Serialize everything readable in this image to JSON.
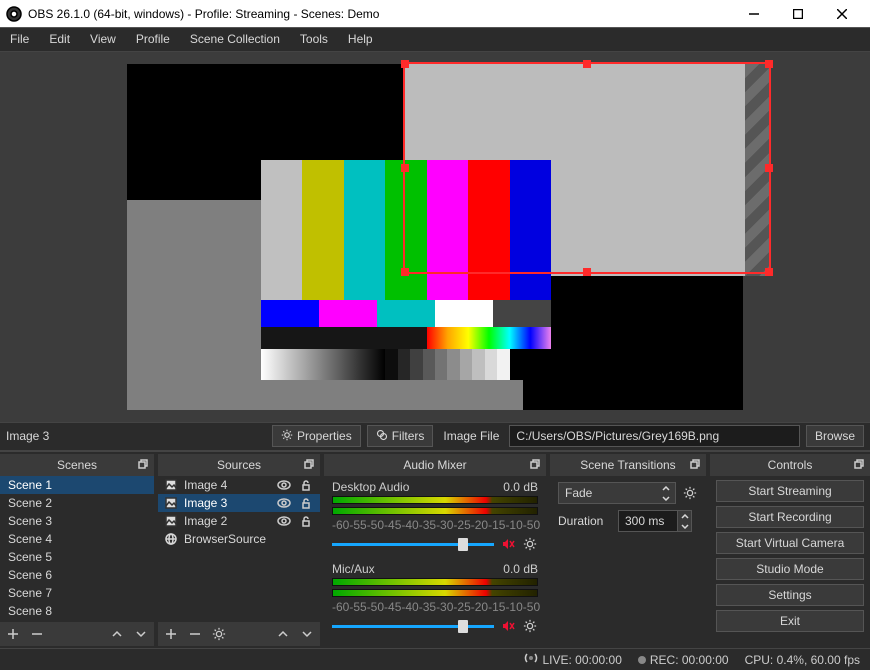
{
  "titlebar": {
    "title": "OBS 26.1.0 (64-bit, windows) - Profile: Streaming - Scenes: Demo"
  },
  "menubar": [
    "File",
    "Edit",
    "View",
    "Profile",
    "Scene Collection",
    "Tools",
    "Help"
  ],
  "propbar": {
    "selected": "Image 3",
    "properties": "Properties",
    "filters": "Filters",
    "file_label": "Image File",
    "file_path": "C:/Users/OBS/Pictures/Grey169B.png",
    "browse": "Browse"
  },
  "docks": {
    "scenes": {
      "title": "Scenes",
      "items": [
        "Scene 1",
        "Scene 2",
        "Scene 3",
        "Scene 4",
        "Scene 5",
        "Scene 6",
        "Scene 7",
        "Scene 8"
      ],
      "selected_index": 0
    },
    "sources": {
      "title": "Sources",
      "items": [
        {
          "name": "Image 4",
          "icon": "image",
          "visible": true,
          "locked": false,
          "selected": false
        },
        {
          "name": "Image 3",
          "icon": "image",
          "visible": true,
          "locked": false,
          "selected": true
        },
        {
          "name": "Image 2",
          "icon": "image",
          "visible": true,
          "locked": false,
          "selected": false
        },
        {
          "name": "BrowserSource",
          "icon": "globe",
          "visible": true,
          "locked": false,
          "selected": false
        }
      ]
    },
    "mixer": {
      "title": "Audio Mixer",
      "ticks": [
        "-60",
        "-55",
        "-50",
        "-45",
        "-40",
        "-35",
        "-30",
        "-25",
        "-20",
        "-15",
        "-10",
        "-5",
        "0"
      ],
      "tracks": [
        {
          "name": "Desktop Audio",
          "level": "0.0 dB",
          "slider": 0.78
        },
        {
          "name": "Mic/Aux",
          "level": "0.0 dB",
          "slider": 0.78
        }
      ]
    },
    "transitions": {
      "title": "Scene Transitions",
      "transition": "Fade",
      "duration_label": "Duration",
      "duration": "300 ms"
    },
    "controls": {
      "title": "Controls",
      "buttons": [
        "Start Streaming",
        "Start Recording",
        "Start Virtual Camera",
        "Studio Mode",
        "Settings",
        "Exit"
      ]
    }
  },
  "statusbar": {
    "live": "LIVE: 00:00:00",
    "rec": "REC: 00:00:00",
    "cpu": "CPU: 0.4%, 60.00 fps"
  }
}
